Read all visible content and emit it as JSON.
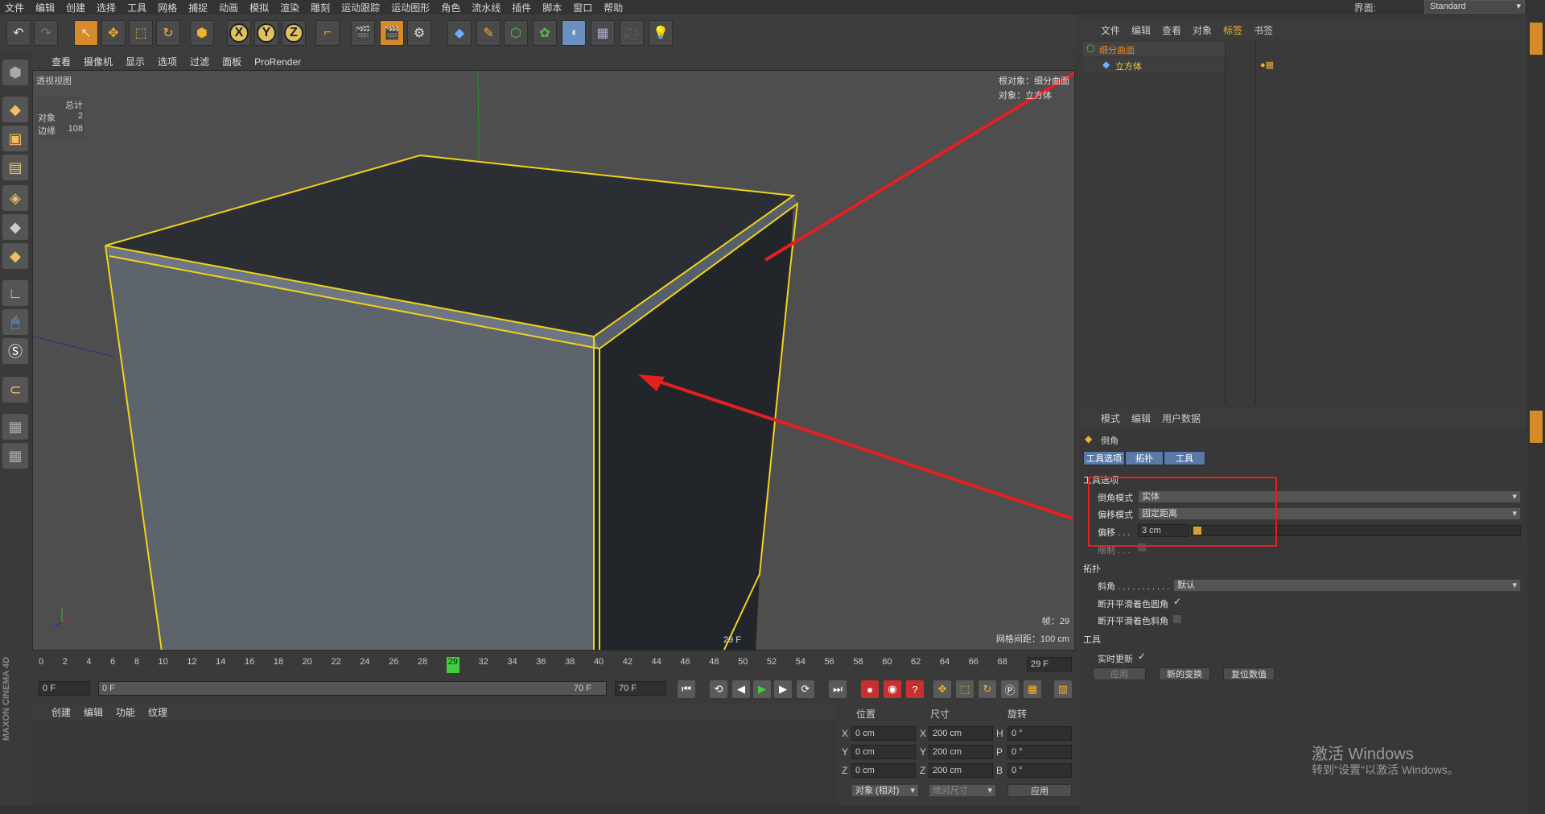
{
  "menubar": {
    "items": [
      "文件",
      "编辑",
      "创建",
      "选择",
      "工具",
      "网格",
      "捕捉",
      "动画",
      "模拟",
      "渲染",
      "雕刻",
      "运动跟踪",
      "运动图形",
      "角色",
      "流水线",
      "插件",
      "脚本",
      "窗口",
      "帮助"
    ],
    "layout_label": "界面:",
    "layout_value": "Standard"
  },
  "toolbar": {
    "axis_x": "X",
    "axis_y": "Y",
    "axis_z": "Z"
  },
  "viewport": {
    "menu": [
      "查看",
      "摄像机",
      "显示",
      "选项",
      "过滤",
      "面板",
      "ProRender"
    ],
    "title": "透视视图",
    "hud_header": "总计",
    "hud_objects_label": "对象",
    "hud_objects_value": "2",
    "hud_edges_label": "边缘",
    "hud_edges_value": "108",
    "root_object": "根对象：细分曲面",
    "object": "对象：立方体",
    "frame_label": "帧：29",
    "frame_marker": "29 F",
    "grid_spacing": "网格间距：100 cm"
  },
  "timeline": {
    "ticks": [
      "0",
      "2",
      "4",
      "6",
      "8",
      "10",
      "12",
      "14",
      "16",
      "18",
      "20",
      "22",
      "24",
      "26",
      "28",
      "29",
      "32",
      "34",
      "36",
      "38",
      "40",
      "42",
      "44",
      "46",
      "48",
      "50",
      "52",
      "54",
      "56",
      "58",
      "60",
      "62",
      "64",
      "66",
      "68",
      "70"
    ],
    "current": "29",
    "end_field": "29 F",
    "start_field": "0 F",
    "range_start": "0 F",
    "range_end": "70 F",
    "max_field": "70 F"
  },
  "bottom_panel": {
    "menu": [
      "创建",
      "编辑",
      "功能",
      "纹理"
    ]
  },
  "coords": {
    "headers": [
      "位置",
      "尺寸",
      "旋转"
    ],
    "rows": [
      {
        "axis": "X",
        "pos": "0 cm",
        "size_axis": "X",
        "size": "200 cm",
        "rot_axis": "H",
        "rot": "0 °"
      },
      {
        "axis": "Y",
        "pos": "0 cm",
        "size_axis": "Y",
        "size": "200 cm",
        "rot_axis": "P",
        "rot": "0 °"
      },
      {
        "axis": "Z",
        "pos": "0 cm",
        "size_axis": "Z",
        "size": "200 cm",
        "rot_axis": "B",
        "rot": "0 °"
      }
    ],
    "mode_select": "对象 (相对)",
    "size_select": "绝对尺寸",
    "apply_button": "应用"
  },
  "object_manager": {
    "menu": [
      "文件",
      "编辑",
      "查看",
      "对象",
      "标签",
      "书签"
    ],
    "items": [
      {
        "name": "细分曲面",
        "color": "#e08a2a"
      },
      {
        "name": "立方体",
        "color": "#f2c94c"
      }
    ]
  },
  "attribute_manager": {
    "menu": [
      "模式",
      "编辑",
      "用户数据"
    ],
    "tool_name": "倒角",
    "tabs": [
      "工具选项",
      "拓扑",
      "工具"
    ],
    "section_tool_options": "工具选项",
    "bevel_mode_label": "倒角模式",
    "bevel_mode_value": "实体",
    "offset_mode_label": "偏移模式",
    "offset_mode_value": "固定距离",
    "offset_label": "偏移 . . .",
    "offset_value": "3 cm",
    "limit_label": "限制 . . .",
    "section_topology": "拓扑",
    "miter_label": "斜角 . . . . . . . . . . .",
    "miter_value": "默认",
    "break_round_label": "断开平滑着色圆角",
    "break_miter_label": "断开平滑着色斜角",
    "section_tool": "工具",
    "realtime_label": "实时更新",
    "apply_button": "应用",
    "new_transform_button": "新的变换",
    "reset_button": "复位数值"
  },
  "windows_activation": {
    "line1": "激活 Windows",
    "line2": "转到\"设置\"以激活 Windows。"
  },
  "colors": {
    "accent_orange": "#d78a2a",
    "selection_yellow": "#f2d21b",
    "annotation_red": "#e42020",
    "tab_blue": "#5a78a8"
  }
}
